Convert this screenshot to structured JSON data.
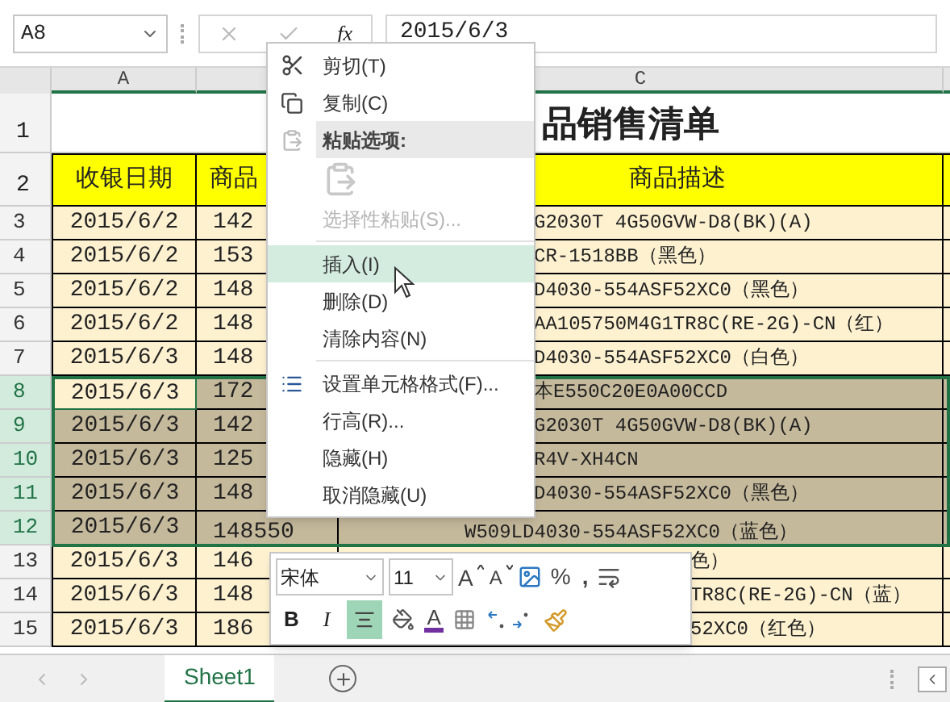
{
  "formula_bar": {
    "name_box": "A8",
    "function_label": "fx",
    "value": "2015/6/3"
  },
  "column_headers": {
    "column_a": "A",
    "column_c": "C"
  },
  "title_row": {
    "number": "1",
    "text": "品销售清单"
  },
  "header_row": {
    "number": "2",
    "col_a": "收银日期",
    "col_b": "商品",
    "col_c": "商品描述"
  },
  "rows": [
    {
      "number": "3",
      "selected": false,
      "active": false,
      "col_a": "2015/6/2",
      "col_b": "142",
      "col_c": "G2030T 4G50GVW-D8(BK)(A)"
    },
    {
      "number": "4",
      "selected": false,
      "active": false,
      "col_a": "2015/6/2",
      "col_b": "153",
      "col_c": "CR-1518BB（黑色）"
    },
    {
      "number": "5",
      "selected": false,
      "active": false,
      "col_a": "2015/6/2",
      "col_b": "148",
      "col_c": "D4030-554ASF52XC0（黑色）"
    },
    {
      "number": "6",
      "selected": false,
      "active": false,
      "col_a": "2015/6/2",
      "col_b": "148",
      "col_c": "AA105750M4G1TR8C(RE-2G)-CN（红）"
    },
    {
      "number": "7",
      "selected": false,
      "active": false,
      "col_a": "2015/6/3",
      "col_b": "148",
      "col_c": "D4030-554ASF52XC0（白色）"
    },
    {
      "number": "8",
      "selected": true,
      "active": true,
      "col_a": "2015/6/3",
      "col_b": "172",
      "col_c": "本E550C20E0A00CCD"
    },
    {
      "number": "9",
      "selected": true,
      "active": false,
      "col_a": "2015/6/3",
      "col_b": "142",
      "col_c": "G2030T 4G50GVW-D8(BK)(A)"
    },
    {
      "number": "10",
      "selected": true,
      "active": false,
      "col_a": "2015/6/3",
      "col_b": "125",
      "col_c": "R4V-XH4CN"
    },
    {
      "number": "11",
      "selected": true,
      "active": false,
      "col_a": "2015/6/3",
      "col_b": "148",
      "col_c": "D4030-554ASF52XC0（黑色）"
    },
    {
      "number": "12",
      "selected": true,
      "active": false,
      "col_a": "2015/6/3",
      "col_b": "148550",
      "col_c": "W509LD4030-554ASF52XC0（蓝色）"
    },
    {
      "number": "13",
      "selected": false,
      "active": false,
      "col_a": "2015/6/3",
      "col_b": "146",
      "col_c": "色）"
    },
    {
      "number": "14",
      "selected": false,
      "active": false,
      "col_a": "2015/6/3",
      "col_b": "148",
      "col_c": "TR8C(RE-2G)-CN（蓝）"
    },
    {
      "number": "15",
      "selected": false,
      "active": false,
      "col_a": "2015/6/3",
      "col_b": "186",
      "col_c": "52XC0（红色）"
    }
  ],
  "context_menu": [
    {
      "kind": "item",
      "label": "剪切(T)",
      "disabled": false,
      "hovered": false
    },
    {
      "kind": "item",
      "label": "复制(C)",
      "disabled": false,
      "hovered": false
    },
    {
      "kind": "header",
      "label": "粘贴选项:"
    },
    {
      "kind": "paste_options"
    },
    {
      "kind": "item",
      "label": "选择性粘贴(S)...",
      "disabled": true,
      "hovered": false
    },
    {
      "kind": "divider"
    },
    {
      "kind": "item",
      "label": "插入(I)",
      "disabled": false,
      "hovered": true
    },
    {
      "kind": "item",
      "label": "删除(D)",
      "disabled": false,
      "hovered": false
    },
    {
      "kind": "item",
      "label": "清除内容(N)",
      "disabled": false,
      "hovered": false
    },
    {
      "kind": "divider"
    },
    {
      "kind": "item",
      "label": "设置单元格格式(F)...",
      "disabled": false,
      "hovered": false
    },
    {
      "kind": "item",
      "label": "行高(R)...",
      "disabled": false,
      "hovered": false
    },
    {
      "kind": "item",
      "label": "隐藏(H)",
      "disabled": false,
      "hovered": false
    },
    {
      "kind": "item",
      "label": "取消隐藏(U)",
      "disabled": false,
      "hovered": false
    }
  ],
  "mini_toolbar": {
    "font": "宋体",
    "size": "11",
    "grow_font": "A",
    "shrink_font": "A",
    "percent": "%",
    "comma": ",",
    "bold": "B",
    "italic": "I",
    "font_color_letter": "A",
    "align_center_selected": true
  },
  "sheet_tabs": [
    {
      "label": "Sheet1",
      "selected": true
    }
  ]
}
